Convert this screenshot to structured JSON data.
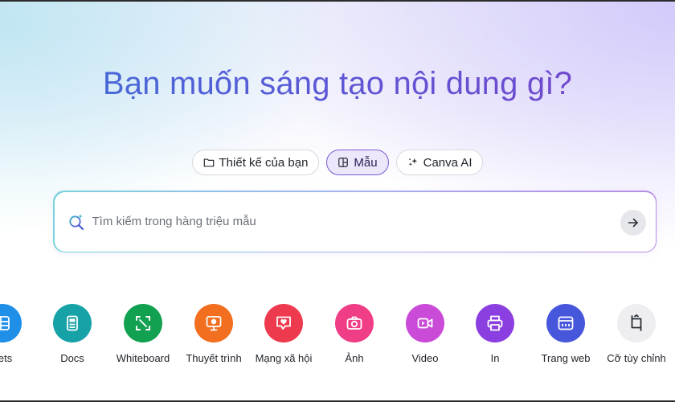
{
  "headline": "Bạn muốn sáng tạo nội dung gì?",
  "tabs": [
    {
      "label": "Thiết kế của bạn",
      "icon": "folder-icon",
      "active": false
    },
    {
      "label": "Mẫu",
      "icon": "template-icon",
      "active": true
    },
    {
      "label": "Canva AI",
      "icon": "sparkle-icon",
      "active": false
    }
  ],
  "search": {
    "placeholder": "Tìm kiếm trong hàng triệu mẫu",
    "value": ""
  },
  "categories": [
    {
      "label": "eets",
      "icon": "sheets-icon",
      "color": "#1f8fe8"
    },
    {
      "label": "Docs",
      "icon": "docs-icon",
      "color": "#17a2a8"
    },
    {
      "label": "Whiteboard",
      "icon": "whiteboard-icon",
      "color": "#12a150"
    },
    {
      "label": "Thuyết trình",
      "icon": "presentation-icon",
      "color": "#f26f1f"
    },
    {
      "label": "Mạng xã hội",
      "icon": "heart-chat-icon",
      "color": "#ee3a4f"
    },
    {
      "label": "Ảnh",
      "icon": "camera-icon",
      "color": "#ef3e86"
    },
    {
      "label": "Video",
      "icon": "video-icon",
      "color": "#c94bd8"
    },
    {
      "label": "In",
      "icon": "printer-icon",
      "color": "#8b3fe0"
    },
    {
      "label": "Trang web",
      "icon": "website-icon",
      "color": "#4657dc"
    },
    {
      "label": "Cỡ tùy chỉnh",
      "icon": "custom-size-icon",
      "color": "#eeeef0"
    }
  ],
  "colors": {
    "accent": "#7a5bd1",
    "headline_start": "#3f6fd8",
    "headline_end": "#7a43c9"
  }
}
